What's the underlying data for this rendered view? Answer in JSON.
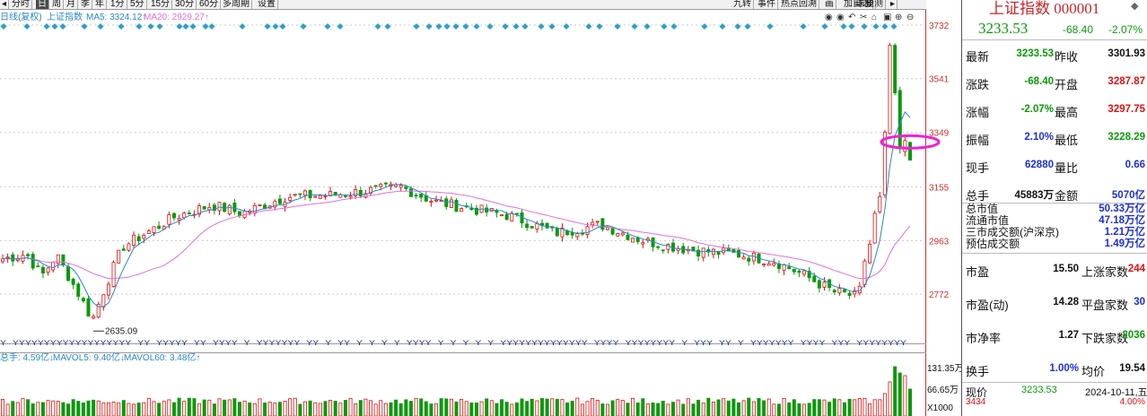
{
  "toolbar": {
    "left": [
      "◂",
      "分时",
      "日",
      "周",
      "月",
      "季",
      "年",
      "1分",
      "5分",
      "15分",
      "30分",
      "60分",
      "多周期",
      "设置"
    ],
    "active_index": 2,
    "right": [
      "九转",
      "事件",
      "热点回溯",
      "画",
      "加自选",
      "球线",
      "预测",
      "▸"
    ]
  },
  "indicator_bar": {
    "mode": "日线(复权)",
    "index_name": "上证指数",
    "ma5": "MA5: 3324.12↑",
    "ma20": "MA20: 2929.27↑",
    "icons": [
      "eye-icon",
      "eye-icon",
      "undo-icon",
      "scissors-icon",
      "lock-icon",
      "save-icon",
      "zoom-in-icon",
      "zoom-out-icon"
    ]
  },
  "price_axis": [
    "3732",
    "3541",
    "3349",
    "3155",
    "2963",
    "2772"
  ],
  "low_marker": "2635.09",
  "volume_bar": {
    "total": "总手: 4.59亿↓",
    "mavol5": "MAVOL5: 9.40亿↓",
    "mavol60": "MAVOL60: 3.48亿↑"
  },
  "volume_axis": [
    "131.35万",
    "66.65万",
    "X1000"
  ],
  "colors": {
    "up": "#e01010",
    "down": "#0a9a0a",
    "ma5": "#2a86c8",
    "ma20": "#e36fd6",
    "highlight": "#ee22d6",
    "marker": "#2fa0c8"
  },
  "y_markers_text": "Y  YYYYYYYYYYYYYYYYYYY    YY  YYYYY  YY  YYYY   Y  YYYYYYY    YY  Y  YY  Y  Y  Y  Y  YYYY  Y  Y  Y  Y  Y  YYYYYYYYYYYYYY  YYYY  YYYYYYYY  Y  YYY  YY  Y  YYYYYYY  YYYY  YYY  YYYYYYYY",
  "panel": {
    "title": "上证指数 000001",
    "price": "3233.53",
    "change": "-68.40",
    "change_pct": "-2.07%",
    "rows": [
      {
        "l": "最新",
        "v": "3233.53",
        "l2": "昨收",
        "v2": "3301.93"
      },
      {
        "l": "涨跌",
        "v": "-68.40",
        "l2": "开盘",
        "v2": "3287.87"
      },
      {
        "l": "涨幅",
        "v": "-2.07%",
        "l2": "最高",
        "v2": "3297.75"
      },
      {
        "l": "振幅",
        "v": "2.10%",
        "l2": "最低",
        "v2": "3228.29"
      },
      {
        "l": "现手",
        "v": "62880",
        "l2": "量比",
        "v2": "0.66"
      },
      {
        "l": "总手",
        "v": "45883万",
        "l2": "金额",
        "v2": "5070亿"
      }
    ],
    "market": [
      {
        "l": "总市值",
        "v": "50.33万亿"
      },
      {
        "l": "流通市值",
        "v": "47.18万亿"
      },
      {
        "l": "三市成交额(沪深京)",
        "v": "1.21万亿"
      },
      {
        "l": "预估成交额",
        "v": "1.49万亿"
      }
    ],
    "stats": [
      {
        "l": "市盈",
        "v": "15.50",
        "l2": "上涨家数",
        "v2": "244"
      },
      {
        "l": "市盈(动)",
        "v": "14.28",
        "l2": "平盘家数",
        "v2": "30"
      },
      {
        "l": "市净率",
        "v": "1.27",
        "l2": "下跌家数",
        "v2": "2036"
      },
      {
        "l": "换手",
        "v": "1.00%",
        "l2": "均价",
        "v2": "19.54"
      }
    ],
    "bottom": {
      "l": "现价",
      "v": "3233.53",
      "date": "2024-10-11,五"
    },
    "foot_left": "3434",
    "foot_right": "4.00%"
  }
}
